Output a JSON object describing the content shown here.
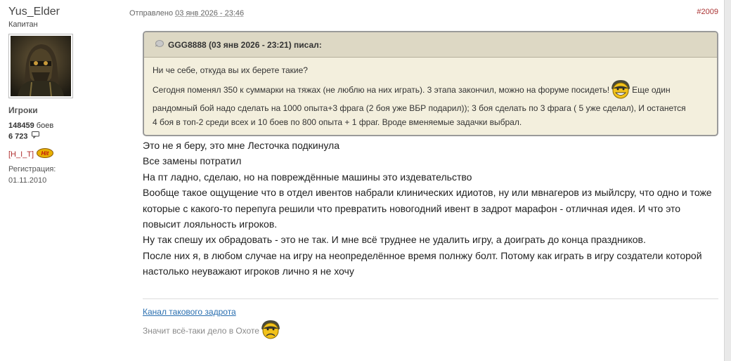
{
  "author": {
    "name": "Yus_Elder",
    "rank": "Капитан",
    "group": "Игроки",
    "battles_value": "148459",
    "battles_label": "боев",
    "messages_value": "6 723",
    "clan_tag": "[H_I_T]",
    "clan_logo_text": "Hit",
    "registration_label": "Регистрация:",
    "registration_date": "01.11.2010"
  },
  "post": {
    "sent_label": "Отправлено",
    "date": "03 янв 2026 - 23:46",
    "number": "#2009",
    "quote": {
      "header": "GGG8888 (03 янв 2026 - 23:21) писал:",
      "line1": "Ни че  себе, откуда  вы их берете такие?",
      "line2a": "Сегодня поменял 350 к  суммарки на  тяжах (не люблю на  них играть). 3 этапа закончил, можно на  форуме  посидеть!",
      "line2b": " Еще один",
      "line3": "рандомный бой  надо сделать на  1000 опыта+3 фрага (2 боя  уже  ВБР подарил));  3 боя сделать по  3  фрага ( 5 уже  сделал), И останется",
      "line4": "4 боя в  топ-2 среди  всех и  10 боев по  800 опыта + 1 фраг. Вроде  вменяемые  задачки выбрал."
    },
    "body_lines": [
      "Это не я беру, это мне Лесточка подкинула",
      "Все замены потратил",
      "На пт ладно, сделаю, но на повреждённые машины это издевательство",
      "Вообще такое ощущение что в отдел ивентов набрали клинических идиотов, ну или мвнагеров из мыйлсру, что одно и тоже",
      "которые с какого-то перепуга решили что превратить новогодний ивент в задрот марафон - отличная идея. И что это",
      "повысит лояльность игроков.",
      "Ну так спешу их обрадовать - это не так. И мне всё труднее не удалить игру, а доиграть до конца праздников.",
      "После них я, в любом случае на игру на неопределённое время полнжу болт. Потому как играть в игру создатели которой",
      "настолько неуважают игроков лично я не хочу"
    ],
    "signature": {
      "link": "Канал такового задрота",
      "text": "Значит всё-таки  дело в Охоте"
    }
  },
  "colors": {
    "quote_bg": "#f3efdd",
    "quote_header_bg": "#ddd8c4",
    "post_number": "#aa3333",
    "link": "#2a6fb0",
    "clan_tag": "#b03030"
  },
  "icons": {
    "message": "speech-bubble-icon",
    "quote": "quote-bubble-icon",
    "smiley_happy": "grinning-soldier-smiley",
    "smiley_sad": "sad-soldier-smiley"
  }
}
